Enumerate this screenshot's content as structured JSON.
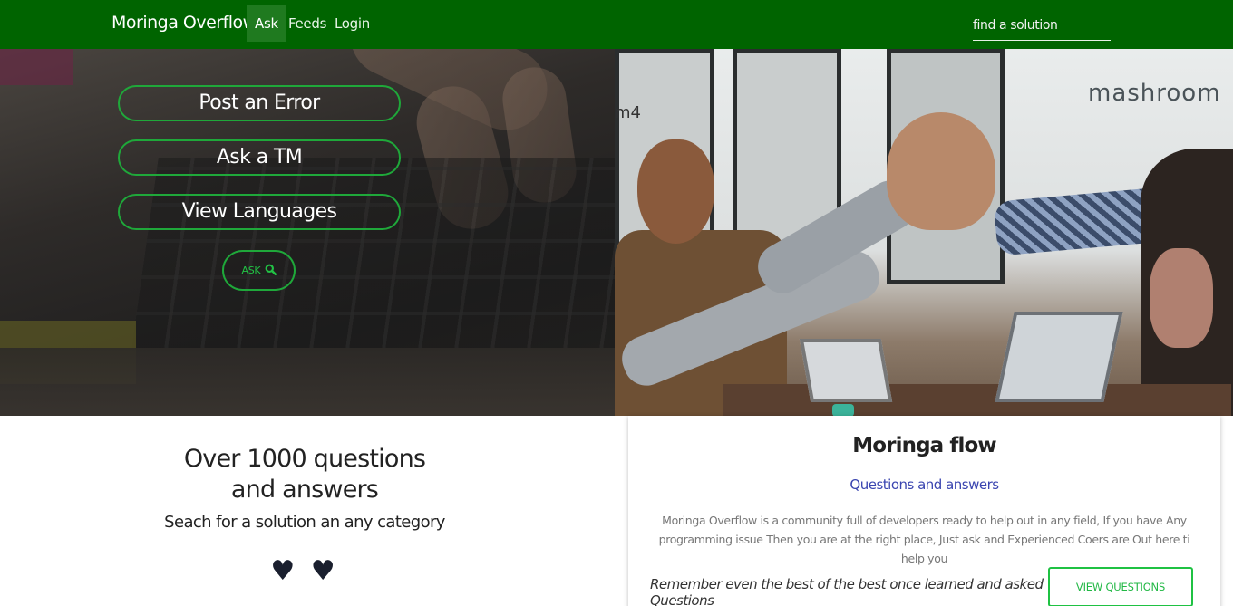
{
  "navbar": {
    "brand": "Moringa Overflow",
    "links": [
      {
        "label": "Ask",
        "active": true
      },
      {
        "label": "Feeds",
        "active": false
      },
      {
        "label": "Login",
        "active": false
      }
    ],
    "search": {
      "placeholder": "find a solution",
      "value": ""
    }
  },
  "hero": {
    "buttons": [
      {
        "label": "Post an Error"
      },
      {
        "label": "Ask a TM"
      },
      {
        "label": "View Languages"
      }
    ],
    "ask_button": {
      "label": "ASK",
      "icon": "search-icon"
    },
    "photo_signage": {
      "wall_text": "mashroom",
      "logo_text": "m4"
    }
  },
  "stats": {
    "title": "Over 1000 questions and answers",
    "subtitle": "Seach for a solution an any category",
    "hearts": "♥ ♥"
  },
  "card": {
    "title": "Moringa flow",
    "subtitle": "Questions and answers",
    "text": "Moringa Overflow is a community full of developers ready to help out in any field, If you have Any programming issue Then you are at the right place, Just ask and Experienced Coers are Out here ti help you",
    "quote": "Remember even the best of the best once learned and asked Questions",
    "button": "VIEW QUESTIONS"
  },
  "colors": {
    "navbar": "#006400",
    "accent_green": "#1fa83a",
    "subtitle_blue": "#3a45b0"
  }
}
